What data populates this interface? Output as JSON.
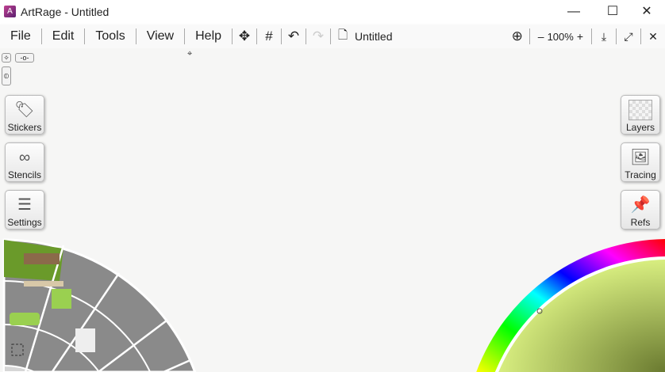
{
  "window": {
    "title": "ArtRage - Untitled",
    "minimize": "—",
    "maximize": "☐",
    "close": "✕"
  },
  "menu": {
    "items": [
      "File",
      "Edit",
      "Tools",
      "View",
      "Help"
    ]
  },
  "toolbar": {
    "document_name": "Untitled",
    "zoom": "100%",
    "zoom_out": "–",
    "zoom_in": "+"
  },
  "left_panels": [
    "Stickers",
    "Stencils",
    "Settings"
  ],
  "right_panels": [
    "Layers",
    "Tracing",
    "Refs"
  ]
}
